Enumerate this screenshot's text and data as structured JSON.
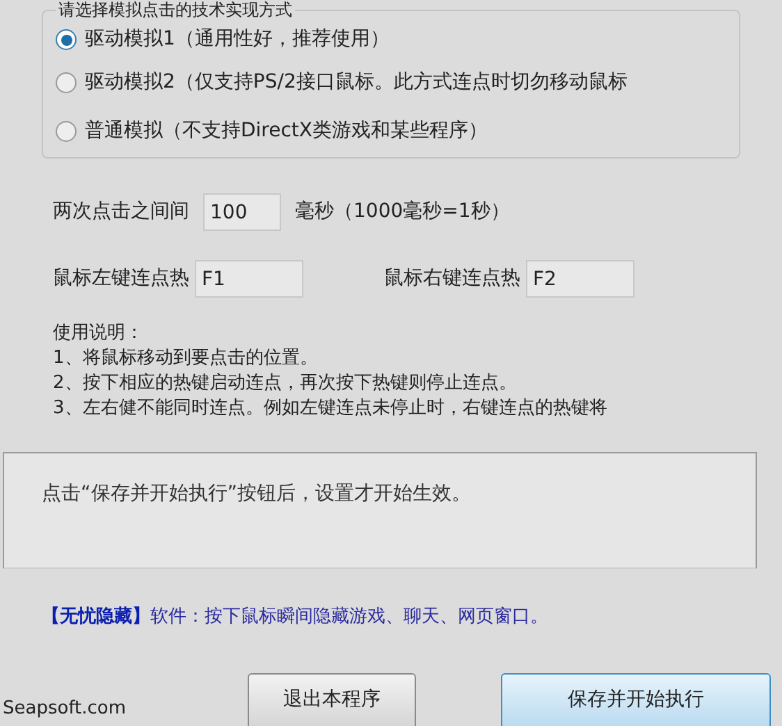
{
  "mode_group": {
    "label": "请选择模拟点击的技术实现方式",
    "options": [
      {
        "label": "驱动模拟1（通用性好，推荐使用）",
        "selected": true
      },
      {
        "label": "驱动模拟2（仅支持PS/2接口鼠标。此方式连点时切勿移动鼠标",
        "selected": false
      },
      {
        "label": "普通模拟（不支持DirectX类游戏和某些程序）",
        "selected": false
      }
    ]
  },
  "interval": {
    "label": "两次点击之间间",
    "value": "100",
    "unit": "毫秒（1000毫秒=1秒）"
  },
  "hotkeys": [
    {
      "label": "鼠标左键连点热",
      "value": "F1"
    },
    {
      "label": "鼠标右键连点热",
      "value": "F2"
    }
  ],
  "instructions": [
    "使用说明：",
    "1、将鼠标移动到要点击的位置。",
    "2、按下相应的热键启动连点，再次按下热键则停止连点。",
    "3、左右健不能同时连点。例如左键连点未停止时，右键连点的热键将"
  ],
  "notice": "点击“保存并开始执行”按钮后，设置才开始生效。",
  "promo": {
    "bracket": "【无忧隐藏】",
    "text": "软件：按下鼠标瞬间隐藏游戏、聊天、网页窗口。"
  },
  "footer": "Seapsoft.com",
  "buttons": [
    {
      "label": "退出本程序",
      "kind": "normal"
    },
    {
      "label": "保存并开始执行",
      "kind": "default"
    }
  ]
}
